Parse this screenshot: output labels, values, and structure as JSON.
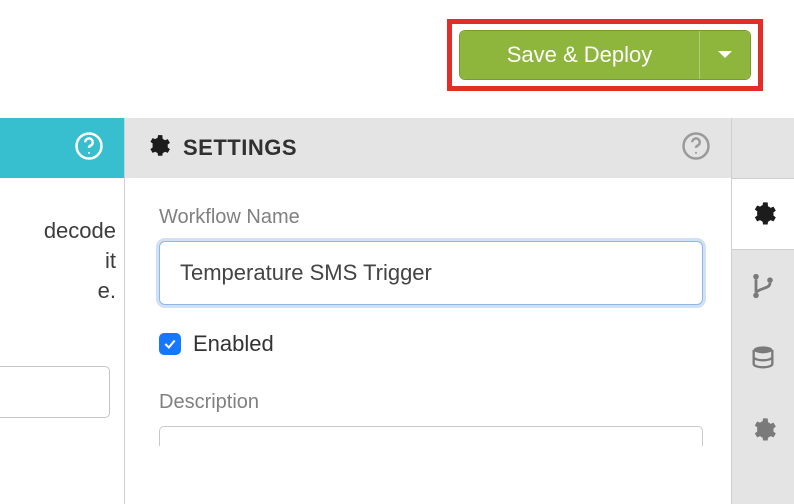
{
  "topbar": {
    "save_label": "Save & Deploy"
  },
  "left_fragment": {
    "line1": "decode",
    "line2": "it",
    "line3": "e."
  },
  "settings": {
    "title": "SETTINGS",
    "workflow_name_label": "Workflow Name",
    "workflow_name_value": "Temperature SMS Trigger",
    "enabled_label": "Enabled",
    "enabled_checked": true,
    "description_label": "Description"
  },
  "icons": {
    "help": "help-circle-icon",
    "gear": "gear-icon",
    "branch": "branch-icon",
    "database": "database-icon",
    "cog": "cog-icon",
    "chevron_down": "chevron-down-icon",
    "check": "check-icon"
  }
}
